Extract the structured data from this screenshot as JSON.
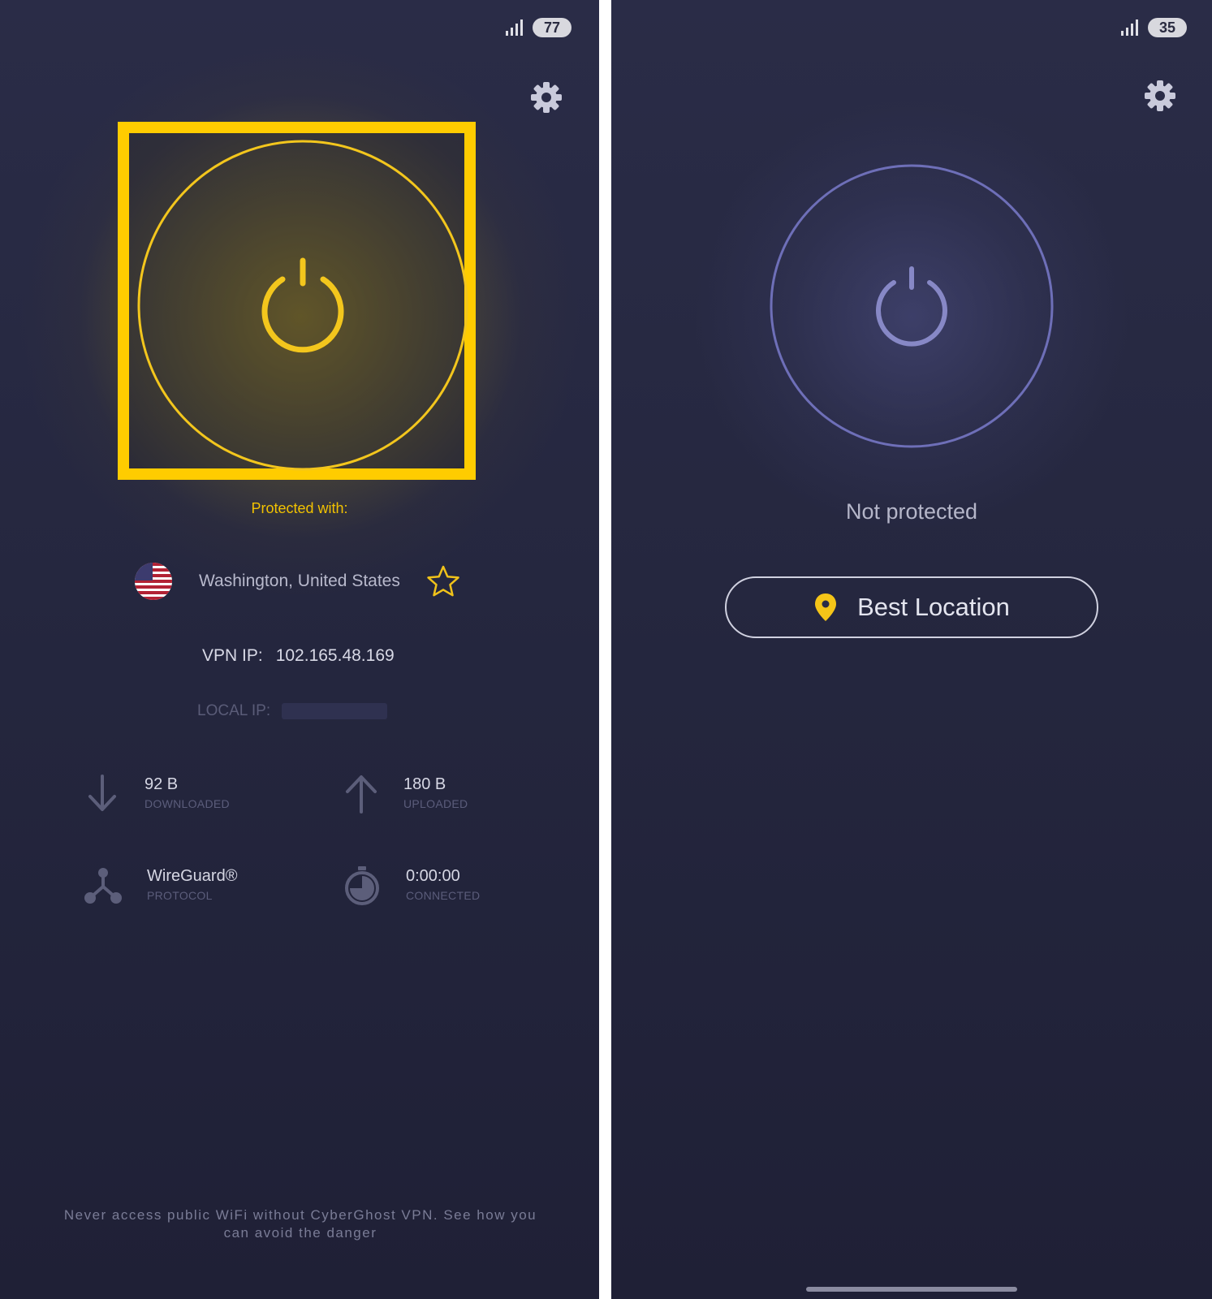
{
  "colors": {
    "accent_yellow": "#ffcc00",
    "background": "#25273f",
    "ring_idle": "#6e6fb8"
  },
  "connected_screen": {
    "battery": "77",
    "protected_label": "Protected with:",
    "location": "Washington, United States",
    "vpn_ip_label": "VPN IP:",
    "vpn_ip_value": "102.165.48.169",
    "local_ip_label": "LOCAL IP:",
    "downloaded_value": "92 B",
    "downloaded_caption": "DOWNLOADED",
    "uploaded_value": "180 B",
    "uploaded_caption": "UPLOADED",
    "protocol_value": "WireGuard®",
    "protocol_caption": "PROTOCOL",
    "connected_value": "0:00:00",
    "connected_caption": "CONNECTED",
    "tip": "Never access public WiFi without CyberGhost VPN. See how you can avoid the danger"
  },
  "disconnected_screen": {
    "battery": "35",
    "status": "Not protected",
    "location_button": "Best Location"
  }
}
